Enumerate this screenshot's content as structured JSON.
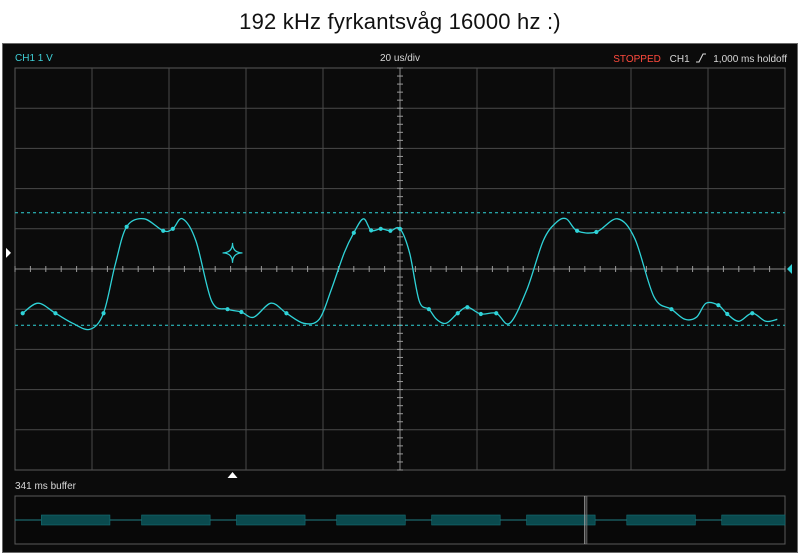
{
  "page": {
    "title": "192 kHz fyrkantsvåg 16000 hz :)"
  },
  "scope": {
    "channel_label": "CH1 1 V",
    "timebase_label": "20 us/div",
    "status": "STOPPED",
    "trigger_channel": "CH1",
    "trigger_edge_icon": "rising-edge-icon",
    "holdoff_label": "1,000 ms holdoff",
    "buffer_label": "341 ms buffer",
    "colors": {
      "trace": "#2fd3d8",
      "status": "#ff4a3d",
      "grid": "#4a4a4a",
      "buffer_segment": "#0a4a4e"
    }
  },
  "chart_data": {
    "type": "line",
    "title": "",
    "xlabel": "",
    "ylabel": "",
    "grid": true,
    "x_unit": "us",
    "x_per_division": 20,
    "y_unit": "V",
    "y_per_division": 1,
    "x_divisions": 10,
    "y_divisions": 10,
    "xlim": [
      -100,
      100
    ],
    "ylim": [
      -5,
      5
    ],
    "trigger_level": 0.4,
    "cursor_levels": [
      1.4,
      -1.4
    ],
    "series": [
      {
        "x": [
          -98,
          -94,
          -89.5,
          -85,
          -80.5,
          -77,
          -74,
          -71,
          -66.5,
          -61.5,
          -59,
          -56.5,
          -53,
          -48.9,
          -44.8,
          -41.2,
          -38,
          -33.5,
          -29.5,
          -25,
          -21,
          -17.8,
          -14.5,
          -12,
          -9.5,
          -7.5,
          -5,
          -2.5,
          0,
          2.5,
          5,
          7.5,
          9.5,
          12,
          15,
          17.5,
          21,
          25,
          28.5,
          33,
          37.2,
          40.5,
          43.2,
          46,
          51,
          56.5,
          61,
          66,
          70.5,
          74,
          77,
          79.5,
          82.7,
          85,
          88,
          91.5,
          95,
          98
        ],
        "y": [
          -1.1,
          -0.85,
          -1.1,
          -1.35,
          -1.5,
          -1.1,
          0.1,
          1.05,
          1.25,
          0.95,
          1.0,
          1.25,
          0.7,
          -0.8,
          -1.0,
          -1.07,
          -1.2,
          -0.85,
          -1.1,
          -1.35,
          -1.25,
          -0.5,
          0.4,
          0.9,
          1.25,
          0.96,
          1.0,
          0.95,
          1.0,
          0.4,
          -0.8,
          -1.0,
          -1.25,
          -1.35,
          -1.1,
          -0.95,
          -1.12,
          -1.1,
          -1.35,
          -0.5,
          0.7,
          1.15,
          1.25,
          0.95,
          0.92,
          1.25,
          0.75,
          -0.7,
          -1.0,
          -1.25,
          -1.2,
          -0.85,
          -0.9,
          -1.12,
          -1.3,
          -1.1,
          -1.3,
          -1.25
        ]
      }
    ],
    "buffer_segments": [
      [
        0.05,
        0.18
      ],
      [
        0.24,
        0.37
      ],
      [
        0.42,
        0.55
      ],
      [
        0.61,
        0.74
      ],
      [
        0.79,
        0.92
      ],
      [
        0.97,
        1.1
      ],
      [
        1.16,
        1.29
      ],
      [
        1.34,
        1.47
      ]
    ],
    "buffer_marker": 0.74
  }
}
